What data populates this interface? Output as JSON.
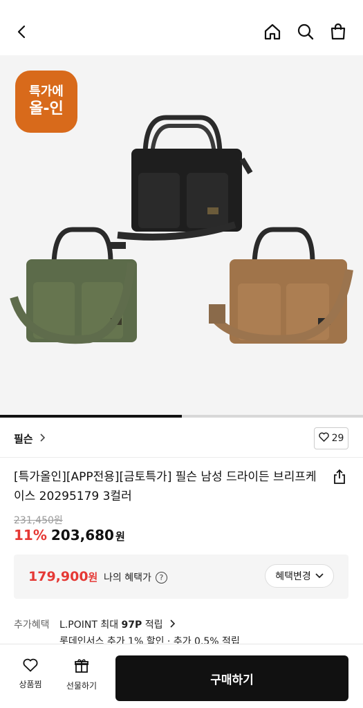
{
  "header": {
    "back_icon": "chevron-left-icon",
    "home_icon": "home-icon",
    "search_icon": "search-icon",
    "cart_icon": "shopping-bag-icon"
  },
  "hero": {
    "badge_line1": "특가에",
    "badge_line2": "올-인",
    "badge_color": "#d86a1b",
    "carousel_progress": 0.5
  },
  "brand": {
    "name": "필슨",
    "likes": "29"
  },
  "product": {
    "title": "[특가올인][APP전용][금토특가] 필슨 남성 드라이든 브리프케이스 20295179 3컬러",
    "original_price": "231,450원",
    "discount": "11%",
    "price": "203,680",
    "price_unit": "원"
  },
  "benefit": {
    "price": "179,900",
    "price_unit": "원",
    "label": "나의 혜택가",
    "change_button": "혜택변경"
  },
  "extra": {
    "label": "추가혜택",
    "line1_prefix": "L.POINT 최대 ",
    "line1_points": "97P",
    "line1_suffix": " 적립",
    "line2": "롯데인서스 추가 1% 할인 · 추가 0.5% 적립"
  },
  "bottom": {
    "wishlist_label": "상품찜",
    "gift_label": "선물하기",
    "buy_label": "구매하기"
  },
  "colors": {
    "accent_red": "#e53935",
    "buy_button": "#111111"
  }
}
